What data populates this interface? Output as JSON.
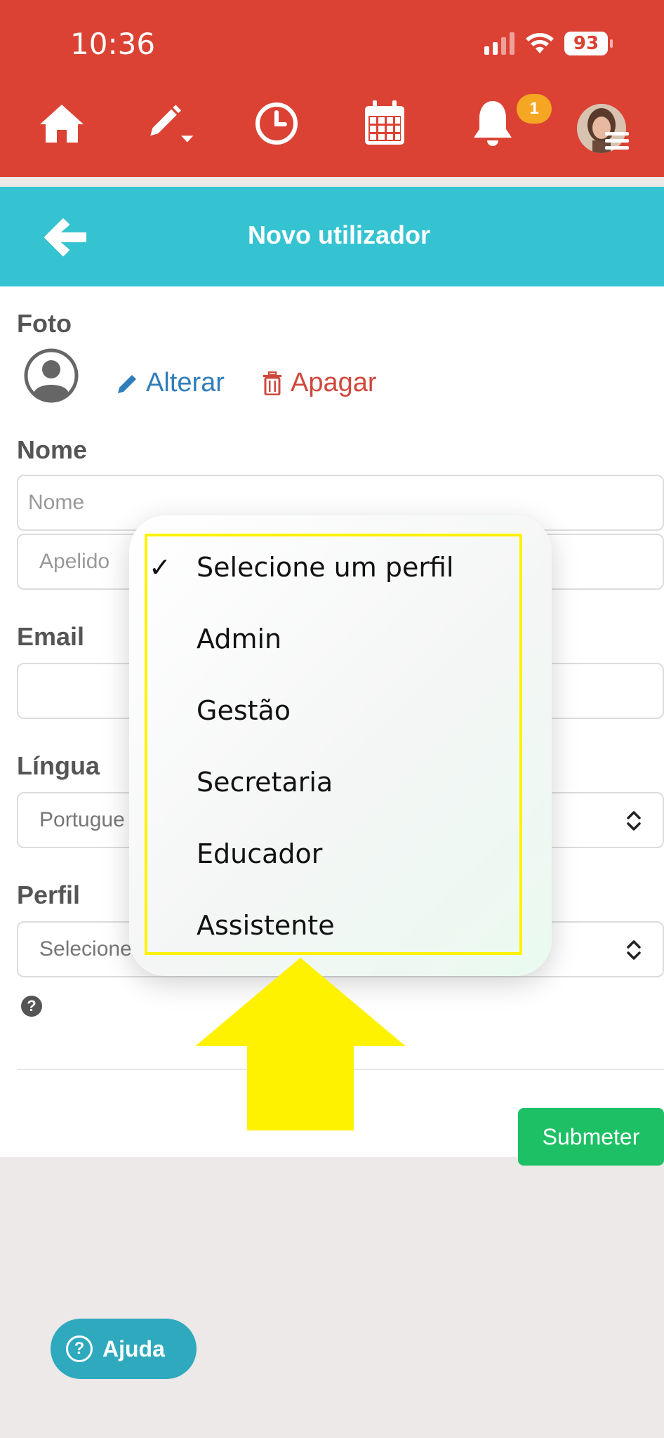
{
  "status_bar": {
    "time": "10:36",
    "battery": "93"
  },
  "nav": {
    "notification_count": "1"
  },
  "header": {
    "title": "Novo utilizador"
  },
  "form": {
    "foto_label": "Foto",
    "alterar_label": "Alterar",
    "apagar_label": "Apagar",
    "nome_label": "Nome",
    "nome_placeholder": "Nome",
    "apelido_placeholder": "Apelido",
    "email_label": "Email",
    "lingua_label": "Língua",
    "lingua_value": "Portugue",
    "perfil_label": "Perfil",
    "perfil_value": "Selecione",
    "submit_label": "Submeter"
  },
  "dropdown": {
    "selected_index": 0,
    "options": [
      "Selecione um perfil",
      "Admin",
      "Gestão",
      "Secretaria",
      "Educador",
      "Assistente"
    ]
  },
  "help_button": {
    "label": "Ajuda"
  },
  "colors": {
    "topbar": "#db4234",
    "header": "#36c3d1",
    "link_blue": "#2f7dbb",
    "link_red": "#d0483c",
    "submit_green": "#1dc064",
    "annotation_yellow": "#fff200"
  }
}
